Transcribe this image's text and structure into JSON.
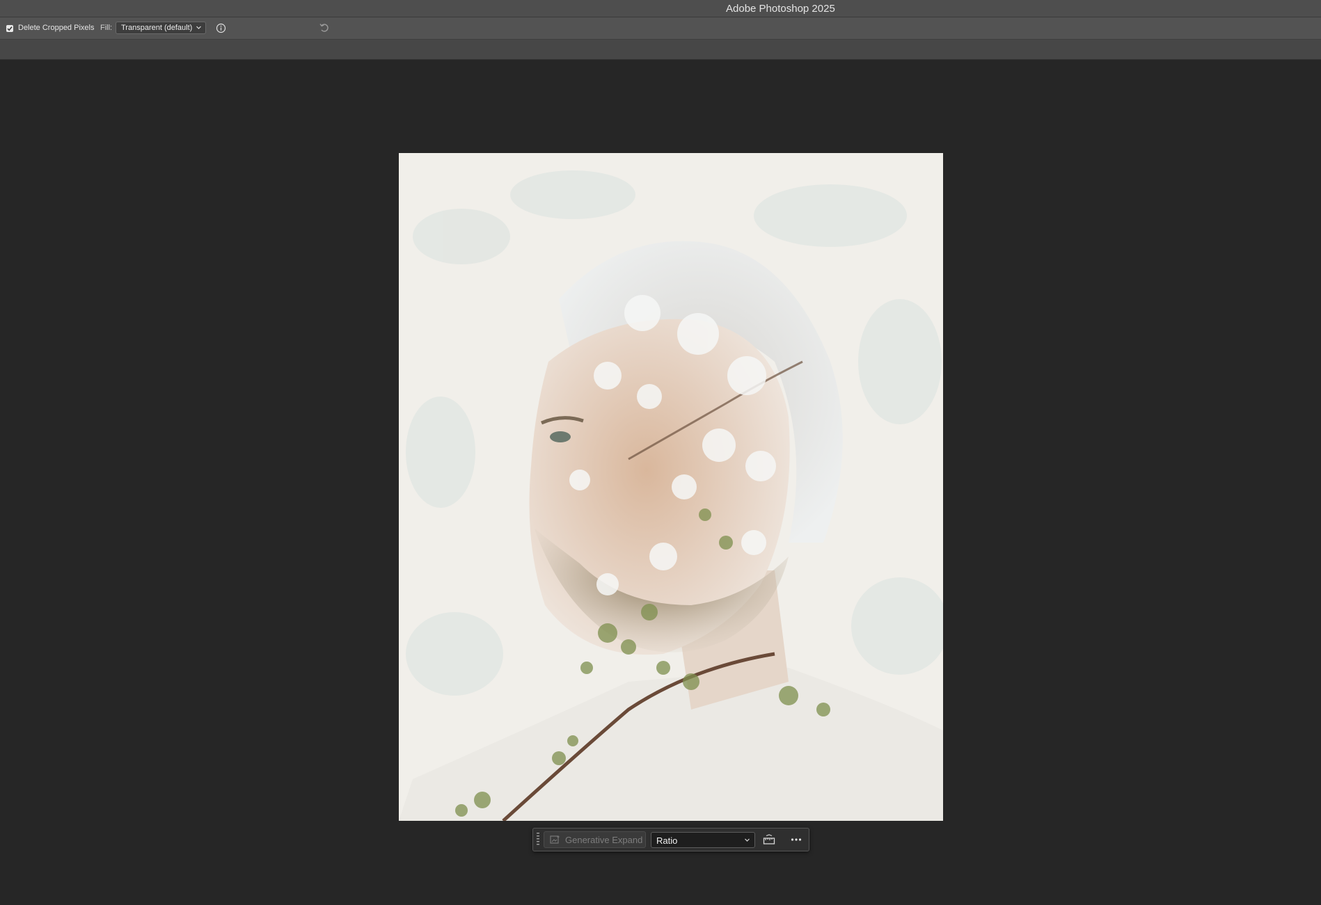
{
  "app": {
    "title": "Adobe Photoshop 2025"
  },
  "options_bar": {
    "delete_cropped_pixels": {
      "label": "Delete Cropped Pixels",
      "checked": true
    },
    "fill": {
      "label": "Fill:",
      "value": "Transparent (default)"
    },
    "icons": [
      "info-icon",
      "reset-icon"
    ]
  },
  "document": {
    "image_description_icon": "photo-double-exposure"
  },
  "contextual_taskbar": {
    "generative_expand_label": "Generative Expand",
    "ratio_value": "Ratio",
    "icons": [
      "grip-icon",
      "generative-expand-icon",
      "straighten-icon",
      "more-options-icon"
    ]
  },
  "colors": {
    "workspace_bg": "#262626",
    "titlebar_bg": "#4e4e4e",
    "options_bg": "#535353",
    "taskbar_bg": "#2f2f2f"
  }
}
